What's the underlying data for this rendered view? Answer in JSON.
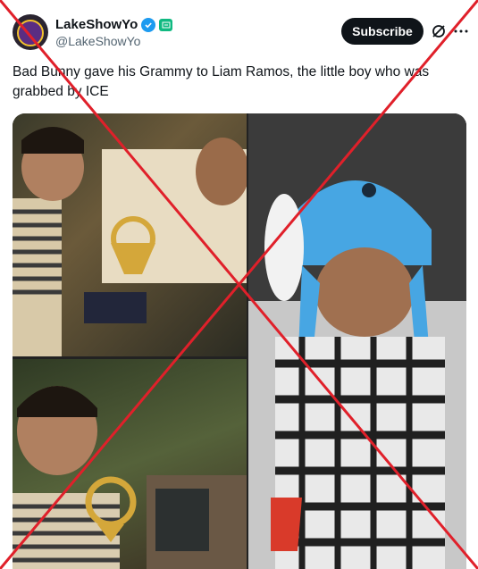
{
  "user": {
    "display_name": "LakeShowYo",
    "handle": "@LakeShowYo"
  },
  "actions": {
    "subscribe_label": "Subscribe"
  },
  "tweet": {
    "text": "Bad Bunny gave his Grammy to Liam Ramos, the little boy who was grabbed by ICE"
  },
  "icons": {
    "avatar": "avatar-icon",
    "verified": "verified-badge-icon",
    "affiliate": "affiliate-badge-icon",
    "grok": "grok-icon",
    "more": "more-icon"
  },
  "colors": {
    "verified_blue": "#1d9bf0",
    "subscribe_bg": "#0f1419",
    "cross_red": "#e0202a"
  }
}
